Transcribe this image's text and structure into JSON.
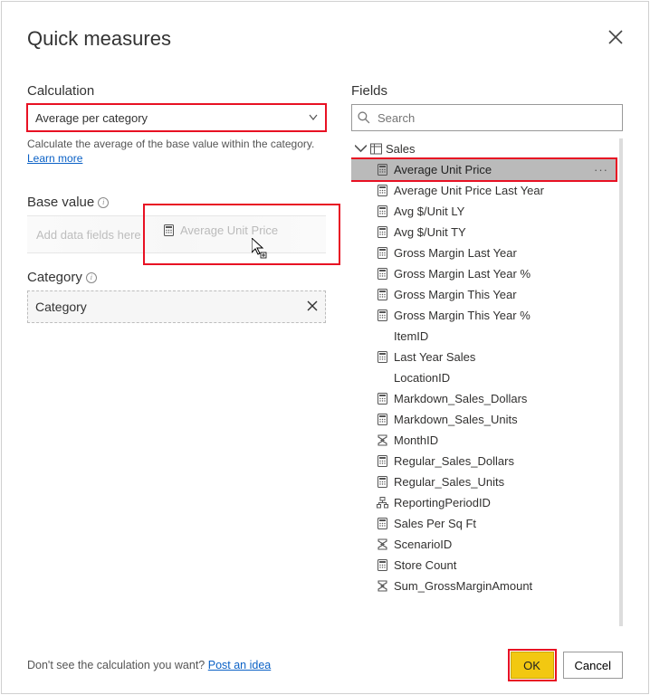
{
  "dialog": {
    "title": "Quick measures"
  },
  "left": {
    "calculation_label": "Calculation",
    "calculation_value": "Average per category",
    "description": "Calculate the average of the base value within the category.",
    "learn_more": "Learn more",
    "basevalue_label": "Base value",
    "basevalue_placeholder": "Add data fields here",
    "drag_item": "Average Unit Price",
    "category_label": "Category",
    "category_value": "Category"
  },
  "right": {
    "fields_label": "Fields",
    "search_placeholder": "Search",
    "table": "Sales",
    "items": [
      {
        "label": "Average Unit Price",
        "icon": "calc",
        "selected": true
      },
      {
        "label": "Average Unit Price Last Year",
        "icon": "calc"
      },
      {
        "label": "Avg $/Unit LY",
        "icon": "calc"
      },
      {
        "label": "Avg $/Unit TY",
        "icon": "calc"
      },
      {
        "label": "Gross Margin Last Year",
        "icon": "calc"
      },
      {
        "label": "Gross Margin Last Year %",
        "icon": "calc"
      },
      {
        "label": "Gross Margin This Year",
        "icon": "calc"
      },
      {
        "label": "Gross Margin This Year %",
        "icon": "calc"
      },
      {
        "label": "ItemID",
        "icon": "none"
      },
      {
        "label": "Last Year Sales",
        "icon": "calc"
      },
      {
        "label": "LocationID",
        "icon": "none"
      },
      {
        "label": "Markdown_Sales_Dollars",
        "icon": "calc"
      },
      {
        "label": "Markdown_Sales_Units",
        "icon": "calc"
      },
      {
        "label": "MonthID",
        "icon": "sigma"
      },
      {
        "label": "Regular_Sales_Dollars",
        "icon": "calc"
      },
      {
        "label": "Regular_Sales_Units",
        "icon": "calc"
      },
      {
        "label": "ReportingPeriodID",
        "icon": "hier"
      },
      {
        "label": "Sales Per Sq Ft",
        "icon": "calc"
      },
      {
        "label": "ScenarioID",
        "icon": "sigma"
      },
      {
        "label": "Store Count",
        "icon": "calc"
      },
      {
        "label": "Sum_GrossMarginAmount",
        "icon": "sigma"
      }
    ]
  },
  "footer": {
    "prompt": "Don't see the calculation you want?",
    "link": "Post an idea",
    "ok": "OK",
    "cancel": "Cancel"
  }
}
